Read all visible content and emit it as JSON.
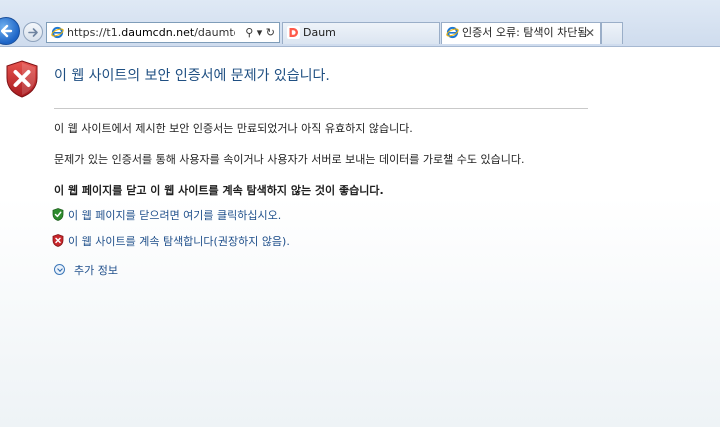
{
  "browser": {
    "address": {
      "url_prefix": "https://t1.",
      "url_domain": "daumcdn.net",
      "url_path": "/daumtop_chan",
      "tools": "⚲ ▾ ↻"
    },
    "tabs": [
      {
        "label": "Daum",
        "active": false
      },
      {
        "label": "인증서 오류: 탐색이 차단됨",
        "active": true
      }
    ],
    "tab_close": "✕"
  },
  "page": {
    "title": "이 웹 사이트의 보안 인증서에 문제가 있습니다.",
    "message1": "이 웹 사이트에서 제시한 보안 인증서는 만료되었거나 아직 유효하지 않습니다.",
    "message2": "문제가 있는 인증서를 통해 사용자를 속이거나 사용자가 서버로 보내는 데이터를 가로챌 수도 있습니다.",
    "recommendation": "이 웹 페이지를 닫고 이 웹 사이트를 계속 탐색하지 않는 것이 좋습니다.",
    "close_link": "이 웹 페이지를 닫으려면 여기를 클릭하십시오.",
    "continue_link": "이 웹 사이트를 계속 탐색합니다(권장하지 않음).",
    "more_info": "추가 정보"
  },
  "colors": {
    "title": "#1f4f82",
    "link": "#1f4f8b",
    "shield_red": "#c8262b",
    "safe_green": "#2e8b2e"
  }
}
